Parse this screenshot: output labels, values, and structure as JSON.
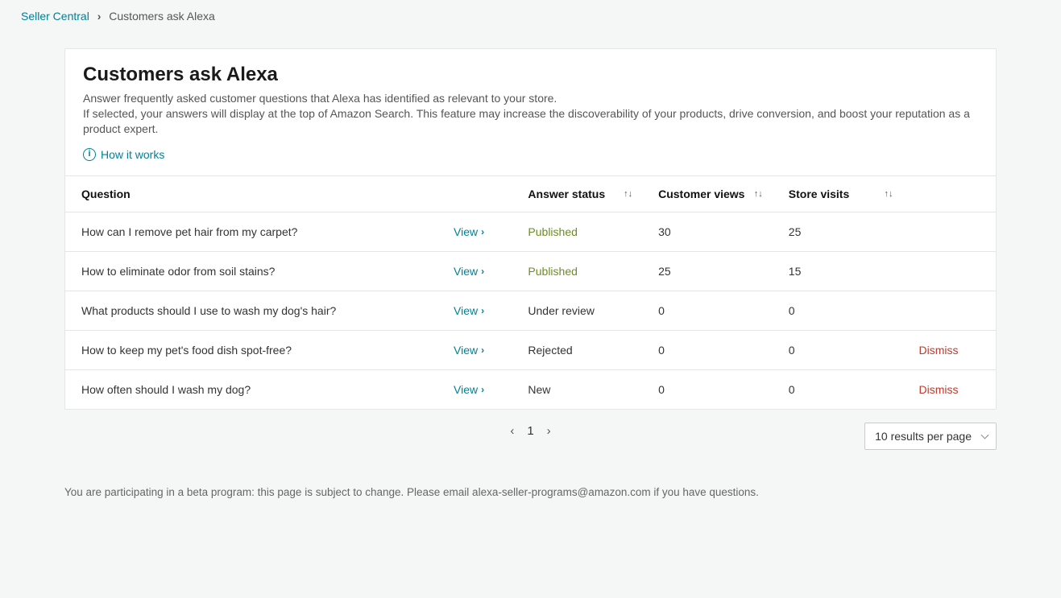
{
  "breadcrumb": {
    "root": "Seller Central",
    "current": "Customers ask Alexa"
  },
  "header": {
    "title": "Customers ask Alexa",
    "desc1": "Answer frequently asked customer questions that Alexa has identified as relevant to your store.",
    "desc2": "If selected, your answers will display at the top of Amazon Search. This feature may increase the discoverability of your products, drive conversion, and boost your reputation as a product expert.",
    "how_it_works": "How it works"
  },
  "table": {
    "columns": {
      "question": "Question",
      "answer_status": "Answer status",
      "customer_views": "Customer views",
      "store_visits": "Store visits"
    },
    "view_label": "View",
    "dismiss_label": "Dismiss",
    "rows": [
      {
        "question": "How can I remove pet hair from my carpet?",
        "status": "Published",
        "status_class": "published",
        "customer_views": "30",
        "store_visits": "25",
        "dismiss": false
      },
      {
        "question": "How to eliminate odor from soil stains?",
        "status": "Published",
        "status_class": "published",
        "customer_views": "25",
        "store_visits": "15",
        "dismiss": false
      },
      {
        "question": "What products should I use to wash my dog's hair?",
        "status": "Under review",
        "status_class": "review",
        "customer_views": "0",
        "store_visits": "0",
        "dismiss": false
      },
      {
        "question": "How to keep my pet's food dish spot-free?",
        "status": "Rejected",
        "status_class": "rejected",
        "customer_views": "0",
        "store_visits": "0",
        "dismiss": true
      },
      {
        "question": "How often should I wash my dog?",
        "status": "New",
        "status_class": "new",
        "customer_views": "0",
        "store_visits": "0",
        "dismiss": true
      }
    ]
  },
  "pagination": {
    "current_page": "1",
    "per_page_label": "10 results per page"
  },
  "footer": {
    "beta_note": "You are participating in a beta program: this page is subject to change. Please email alexa-seller-programs@amazon.com if you have questions."
  }
}
